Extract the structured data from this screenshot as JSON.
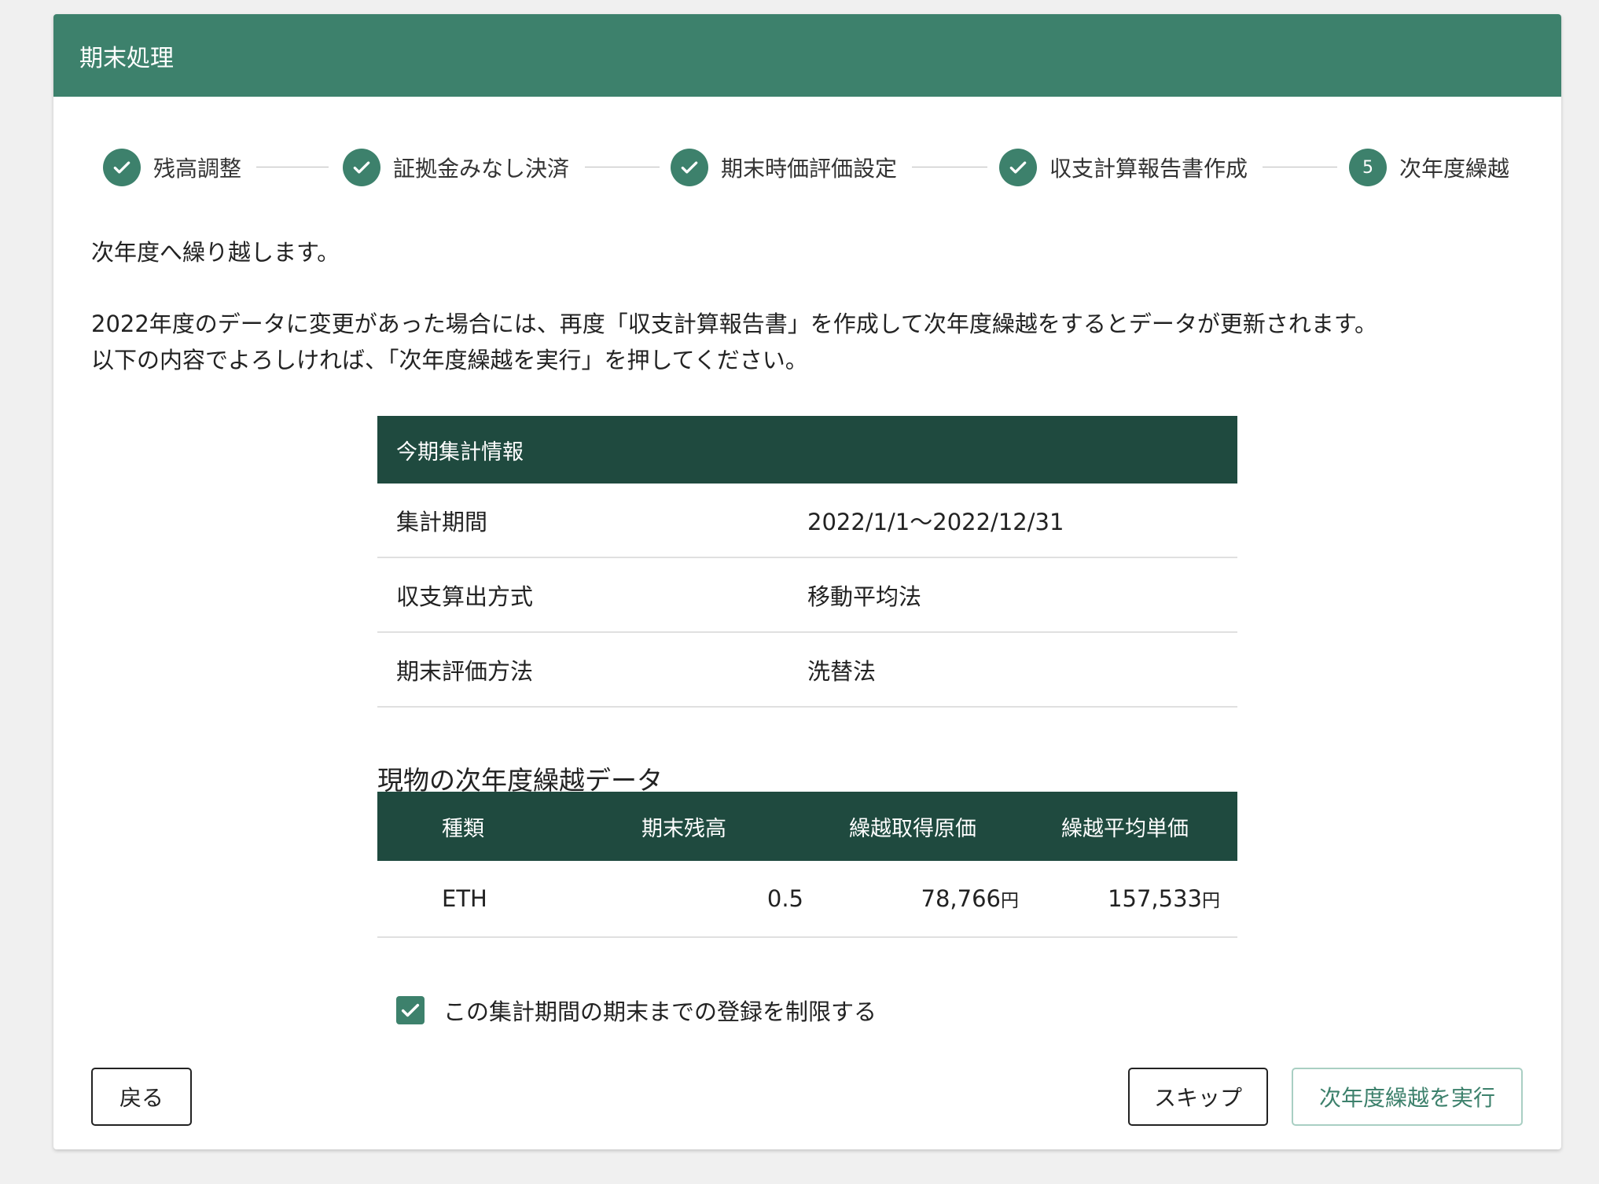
{
  "header": {
    "title": "期末処理"
  },
  "stepper": {
    "steps": [
      {
        "label": "残高調整",
        "marker": "",
        "status": "completed"
      },
      {
        "label": "証拠金みなし決済",
        "marker": "",
        "status": "completed"
      },
      {
        "label": "期末時価評価設定",
        "marker": "",
        "status": "completed"
      },
      {
        "label": "収支計算報告書作成",
        "marker": "",
        "status": "completed"
      },
      {
        "label": "次年度繰越",
        "marker": "5",
        "status": "active"
      }
    ]
  },
  "intro": {
    "line1": "次年度へ繰り越します。",
    "line2": "2022年度のデータに変更があった場合には、再度「収支計算報告書」を作成して次年度繰越をするとデータが更新されます。",
    "line3": "以下の内容でよろしければ、「次年度繰越を実行」を押してください。"
  },
  "summary": {
    "title": "今期集計情報",
    "rows": [
      {
        "label": "集計期間",
        "value": "2022/1/1〜2022/12/31"
      },
      {
        "label": "収支算出方式",
        "value": "移動平均法"
      },
      {
        "label": "期末評価方法",
        "value": "洗替法"
      }
    ]
  },
  "carryover": {
    "title": "現物の次年度繰越データ",
    "columns": [
      "種類",
      "期末残高",
      "繰越取得原価",
      "繰越平均単価"
    ],
    "rows": [
      {
        "type": "ETH",
        "balance": "0.5",
        "cost": "78,766",
        "avg": "157,533",
        "unit": "円"
      }
    ]
  },
  "restrict": {
    "label": "この集計期間の期末までの登録を制限する",
    "checked": true
  },
  "buttons": {
    "back": "戻る",
    "skip": "スキップ",
    "execute": "次年度繰越を実行"
  },
  "colors": {
    "primary": "#3d816c",
    "table_header": "#1f4a3f",
    "background": "#f0f0f0"
  }
}
